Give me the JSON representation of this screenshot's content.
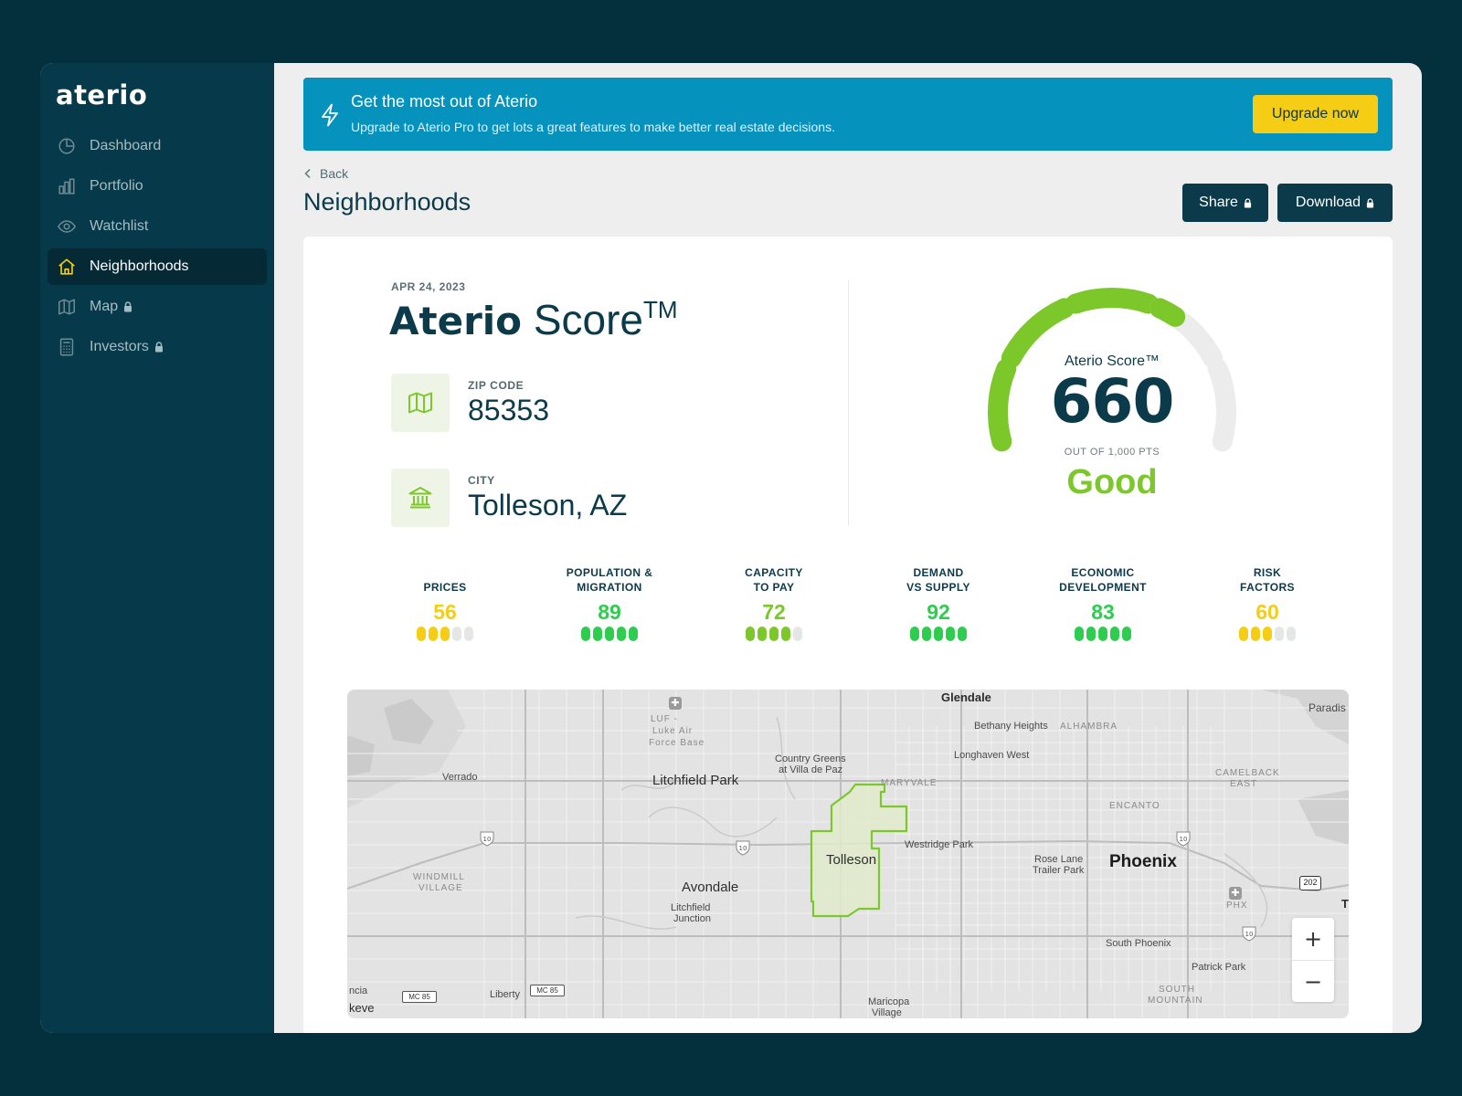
{
  "app": {
    "logo": "aterio"
  },
  "sidebar": {
    "items": [
      {
        "label": "Dashboard",
        "icon": "pie-chart-icon",
        "active": false,
        "locked": false
      },
      {
        "label": "Portfolio",
        "icon": "bar-chart-icon",
        "active": false,
        "locked": false
      },
      {
        "label": "Watchlist",
        "icon": "eye-icon",
        "active": false,
        "locked": false
      },
      {
        "label": "Neighborhoods",
        "icon": "home-icon",
        "active": true,
        "locked": false
      },
      {
        "label": "Map",
        "icon": "map-icon",
        "active": false,
        "locked": true
      },
      {
        "label": "Investors",
        "icon": "calculator-icon",
        "active": false,
        "locked": true
      }
    ]
  },
  "banner": {
    "title": "Get the most out of Aterio",
    "subtitle": "Upgrade to Aterio Pro to get lots a great features to make better real estate decisions.",
    "button": "Upgrade now",
    "icon": "lightning-icon"
  },
  "header": {
    "back": "Back",
    "title": "Neighborhoods",
    "share": "Share",
    "download": "Download"
  },
  "score": {
    "date": "APR 24, 2023",
    "title_brand": "Aterio",
    "title_rest": "Score",
    "title_mark": "TM",
    "zip_label": "ZIP CODE",
    "zip_value": "85353",
    "city_label": "CITY",
    "city_value": "Tolleson, AZ",
    "gauge_label": "Aterio Score™",
    "gauge_value": "660",
    "gauge_max": 1000,
    "gauge_sub": "OUT OF 1,000 PTS",
    "rating": "Good"
  },
  "colors": {
    "green": "#7cc72a",
    "bright_green": "#2ecc4f",
    "yellow": "#f5cd14",
    "navy": "#0b3a4a",
    "banner": "#0592bd"
  },
  "metrics": [
    {
      "line1": "PRICES",
      "line2": "",
      "value": "56",
      "filled": 3,
      "color": "#f5cd14"
    },
    {
      "line1": "POPULATION &",
      "line2": "MIGRATION",
      "value": "89",
      "filled": 5,
      "color": "#2ecc4f"
    },
    {
      "line1": "CAPACITY",
      "line2": "TO PAY",
      "value": "72",
      "filled": 4,
      "color": "#7cc72a"
    },
    {
      "line1": "DEMAND",
      "line2": "VS SUPPLY",
      "value": "92",
      "filled": 5,
      "color": "#2ecc4f"
    },
    {
      "line1": "ECONOMIC",
      "line2": "DEVELOPMENT",
      "value": "83",
      "filled": 5,
      "color": "#2ecc4f"
    },
    {
      "line1": "RISK",
      "line2": "FACTORS",
      "value": "60",
      "filled": 3,
      "color": "#f5cd14"
    }
  ],
  "map": {
    "labels": {
      "glendale": "Glendale",
      "paradise": "Paradis",
      "luke1": "LUF -",
      "luke2": "Luke Air",
      "luke3": "Force Base",
      "bethany": "Bethany Heights",
      "alhambra": "ALHAMBRA",
      "longhaven": "Longhaven West",
      "country1": "Country Greens",
      "country2": "at Villa de Paz",
      "verrado": "Verrado",
      "litchfield_park": "Litchfield Park",
      "maryvale": "MARYVALE",
      "camelback1": "CAMELBACK",
      "camelback2": "EAST",
      "encanto": "ENCANTO",
      "tolleson": "Tolleson",
      "westridge": "Westridge Park",
      "rose1": "Rose Lane",
      "rose2": "Trailer Park",
      "phoenix": "Phoenix",
      "windmill1": "WINDMILL",
      "windmill2": "VILLAGE",
      "avondale": "Avondale",
      "lj1": "Litchfield",
      "lj2": "Junction",
      "phx": "PHX",
      "t": "T",
      "south_phoenix": "South Phoenix",
      "patrick": "Patrick Park",
      "sm1": "SOUTH",
      "sm2": "MOUNTAIN",
      "ncia": "ncia",
      "keve": "keve",
      "liberty": "Liberty",
      "maricopa1": "Maricopa",
      "maricopa2": "Village",
      "i10": "10",
      "mc85": "MC 85",
      "r202": "202"
    },
    "zoom_in": "+",
    "zoom_out": "−"
  }
}
